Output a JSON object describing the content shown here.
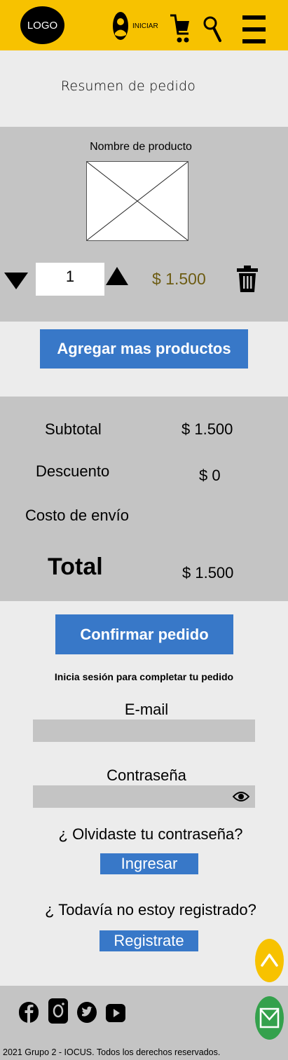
{
  "header": {
    "logo": "LOGO",
    "login_label": "INICIAR",
    "icons": [
      "user-icon",
      "cart-icon",
      "search-icon",
      "menu-icon"
    ],
    "background": "#f7c200"
  },
  "page_title": "Resumen de pedido",
  "product": {
    "name": "Nombre de producto",
    "quantity": "1",
    "price": "$ 1.500"
  },
  "add_more_label": "Agregar mas productos",
  "summary": {
    "subtotal_label": "Subtotal",
    "subtotal_value": "$ 1.500",
    "discount_label": "Descuento",
    "discount_value": "$ 0",
    "shipping_label": "Costo de envío",
    "total_label": "Total",
    "total_value": "$ 1.500"
  },
  "confirm_label": "Confirmar pedido",
  "login": {
    "hint": "Inicia sesión para completar tu pedido",
    "email_label": "E-mail",
    "password_label": "Contraseña",
    "forgot": "¿ Olvidaste tu contraseña?",
    "submit_label": "Ingresar",
    "not_registered": "¿ Todavía no estoy registrado?",
    "register_label": "Registrate"
  },
  "footer": {
    "social_icons": [
      "facebook-icon",
      "instagram-icon",
      "twitter-icon",
      "youtube-icon"
    ],
    "copyright": "2021 Grupo 2 - IOCUS. Todos los derechos reservados."
  },
  "colors": {
    "accent_yellow": "#f7c200",
    "button_blue": "#3878c8",
    "panel_gray": "#c4c4c4",
    "price_text": "#6d5c13",
    "mail_green": "#34a14c"
  }
}
